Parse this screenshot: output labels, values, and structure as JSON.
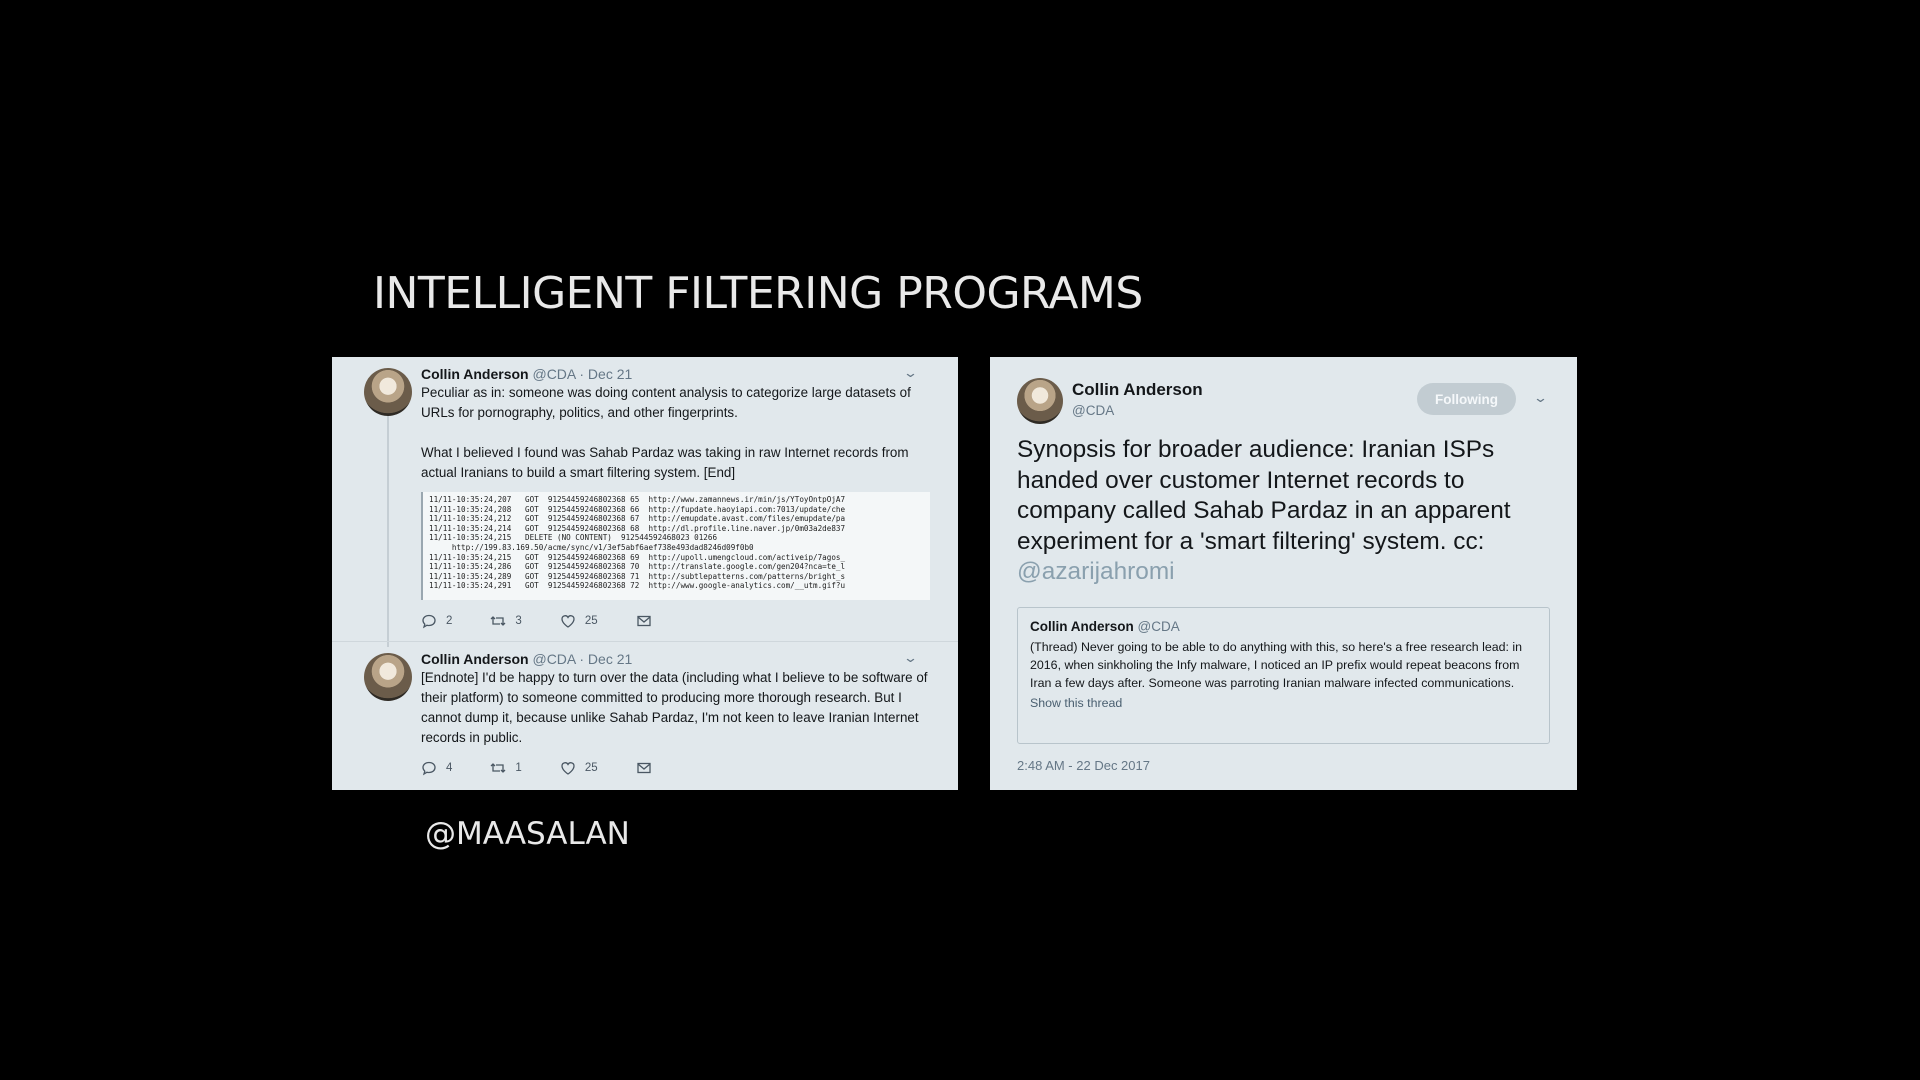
{
  "slide": {
    "title": "INTELLIGENT FILTERING PROGRAMS",
    "footer_handle": "@MAASALAN"
  },
  "tweet1": {
    "name": "Collin Anderson",
    "meta": "@CDA · Dec 21",
    "text_p1": "Peculiar as in: someone was doing content analysis to categorize large datasets of URLs for pornography, politics, and other fingerprints.",
    "text_p2": "What I believed I found was Sahab Pardaz was taking in raw Internet records from actual Iranians to build a smart filtering system. [End]",
    "log_lines": "11/11-10:35:24,207   GOT  91254459246802368 65  http://www.zamannews.ir/min/js/YToyOntpOjA7\n11/11-10:35:24,208   GOT  91254459246802368 66  http://fupdate.haoyiapi.com:7013/update/che\n11/11-10:35:24,212   GOT  91254459246802368 67  http://emupdate.avast.com/files/emupdate/pa\n11/11-10:35:24,214   GOT  91254459246802368 68  http://dl.profile.line.naver.jp/0m03a2de837\n11/11-10:35:24,215   DELETE (NO CONTENT)  912544592468023 01266\n     http://199.83.169.50/acme/sync/v1/3ef5abf6aef738e493dad8246d09f0b0\n11/11-10:35:24,215   GOT  91254459246802368 69  http://upoll.umengcloud.com/activeip/7agos_\n11/11-10:35:24,286   GOT  91254459246802368 70  http://translate.google.com/gen204?nca=te_l\n11/11-10:35:24,289   GOT  91254459246802368 71  http://subtlepatterns.com/patterns/bright_s\n11/11-10:35:24,291   GOT  91254459246802368 72  http://www.google-analytics.com/__utm.gif?u",
    "replies": "2",
    "retweets": "3",
    "likes": "25"
  },
  "tweet2": {
    "name": "Collin Anderson",
    "meta": "@CDA · Dec 21",
    "text": "[Endnote] I'd be happy to turn over the data (including what I believe to be software of their platform) to someone committed to producing more thorough research. But I cannot dump it, because unlike Sahab Pardaz, I'm not keen to leave Iranian Internet records in public.",
    "replies": "4",
    "retweets": "1",
    "likes": "25"
  },
  "tweet_main": {
    "name": "Collin Anderson",
    "handle": "@CDA",
    "follow_label": "Following",
    "text": "Synopsis for broader audience: Iranian ISPs handed over customer Internet records to company called Sahab Pardaz in an apparent experiment for a 'smart filtering' system. cc: ",
    "mention": "@azarijahromi",
    "quote": {
      "name": "Collin Anderson",
      "handle": "@CDA",
      "text": "(Thread) Never going to be able to do anything with this, so here's a free research lead: in 2016, when sinkholing the Infy malware, I noticed an IP prefix would repeat beacons from Iran a few days after. Someone was parroting Iranian malware infected communications.",
      "link": "Show this thread"
    },
    "timestamp": "2:48 AM - 22 Dec 2017"
  },
  "icons": {
    "reply": "reply-icon",
    "retweet": "retweet-icon",
    "like": "heart-icon",
    "dm": "envelope-icon",
    "more": "chevron-down-icon"
  }
}
